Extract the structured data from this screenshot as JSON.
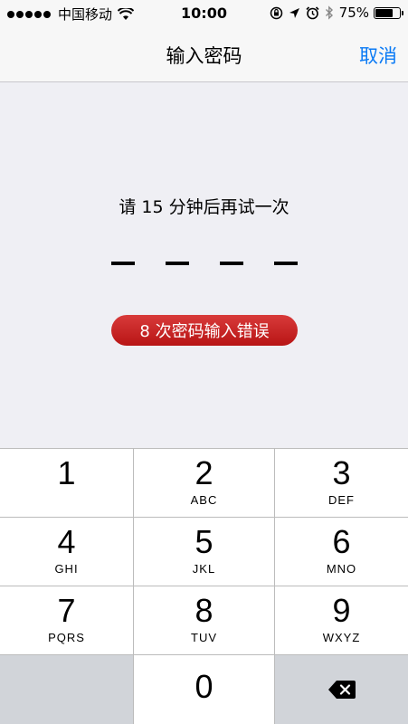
{
  "status_bar": {
    "carrier": "中国移动",
    "time": "10:00",
    "battery_percent": "75%",
    "battery_level": 0.75,
    "icons": [
      "signal-dots-icon",
      "wifi-icon",
      "rotation-lock-icon",
      "location-arrow-icon",
      "alarm-icon",
      "bluetooth-icon",
      "battery-icon"
    ]
  },
  "nav": {
    "title": "输入密码",
    "cancel_label": "取消"
  },
  "message": "请 15 分钟后再试一次",
  "passcode_length": 4,
  "error_badge": "8 次密码输入错误",
  "keypad": {
    "keys": [
      {
        "num": "1",
        "letters": ""
      },
      {
        "num": "2",
        "letters": "ABC"
      },
      {
        "num": "3",
        "letters": "DEF"
      },
      {
        "num": "4",
        "letters": "GHI"
      },
      {
        "num": "5",
        "letters": "JKL"
      },
      {
        "num": "6",
        "letters": "MNO"
      },
      {
        "num": "7",
        "letters": "PQRS"
      },
      {
        "num": "8",
        "letters": "TUV"
      },
      {
        "num": "9",
        "letters": "WXYZ"
      },
      {
        "num": "0",
        "letters": ""
      }
    ],
    "delete_icon": "delete-backspace-icon"
  },
  "colors": {
    "accent": "#0a7af5",
    "error_red": "#c62222",
    "background": "#efeff4"
  }
}
